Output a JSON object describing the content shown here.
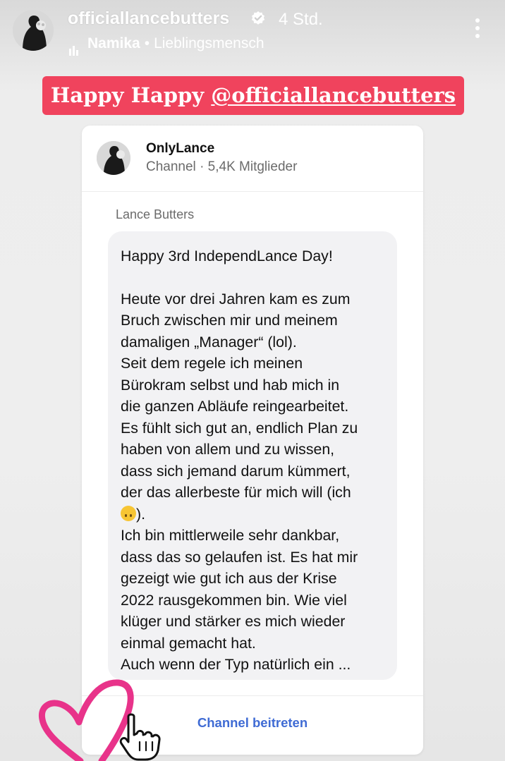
{
  "story": {
    "username": "officiallancebutters",
    "time": "4 Std.",
    "music": {
      "artist": "Namika",
      "separator": "•",
      "song": "Lieblingsmensch"
    }
  },
  "sticker": {
    "prefix": "Happy Happy ",
    "mention": "@officiallancebutters",
    "color": "#f0435d"
  },
  "channel": {
    "name": "OnlyLance",
    "type": "Channel",
    "separator": "·",
    "members": "5,4K Mitglieder",
    "sender": "Lance Butters",
    "message": {
      "title": "Happy 3rd IndependLance Day!",
      "body_before_emoji": "Heute vor drei Jahren kam es zum\nBruch zwischen mir und meinem\ndamaligen „Manager“ (lol).\nSeit dem regele ich meinen\nBürokram selbst und hab mich in\ndie ganzen Abläufe reingearbeitet.\nEs fühlt sich gut an, endlich Plan zu\nhaben von allem und zu wissen,\ndass sich jemand darum kümmert,\nder das allerbeste für mich will (ich\n",
      "emoji": "upside-down-face",
      "body_after_emoji": ").\nIch bin mittlerweile sehr dankbar,\ndass das so gelaufen ist. Es hat mir\ngezeigt wie gut ich aus der Krise\n2022 rausgekommen bin. Wie viel\nklüger und stärker es mich wieder\neinmal gemacht hat.\nAuch wenn der Typ natürlich ein ..."
    },
    "join_label": "Channel beitreten",
    "join_color": "#3f6bd4"
  },
  "decorations": {
    "heart_color": "#e8338a",
    "icons": [
      "heart-doodle",
      "pointing-hand-icon"
    ]
  }
}
